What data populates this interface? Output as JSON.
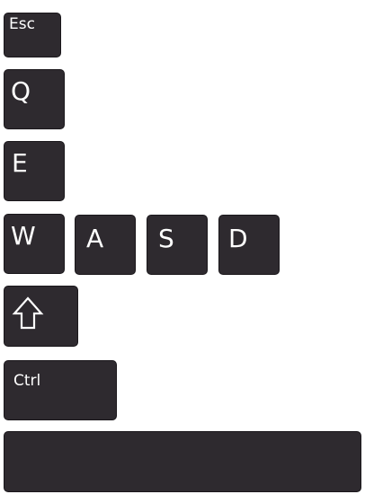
{
  "keys": {
    "esc": {
      "label": "Esc"
    },
    "q": {
      "label": "Q"
    },
    "e": {
      "label": "E"
    },
    "w": {
      "label": "W"
    },
    "a": {
      "label": "A"
    },
    "s": {
      "label": "S"
    },
    "d": {
      "label": "D"
    },
    "shift": {
      "icon": "shift-arrow-icon"
    },
    "ctrl": {
      "label": "Ctrl"
    },
    "space": {
      "label": ""
    }
  },
  "colors": {
    "key_face": "#2e2a2f",
    "key_text": "#ffffff",
    "background": "#ffffff"
  }
}
